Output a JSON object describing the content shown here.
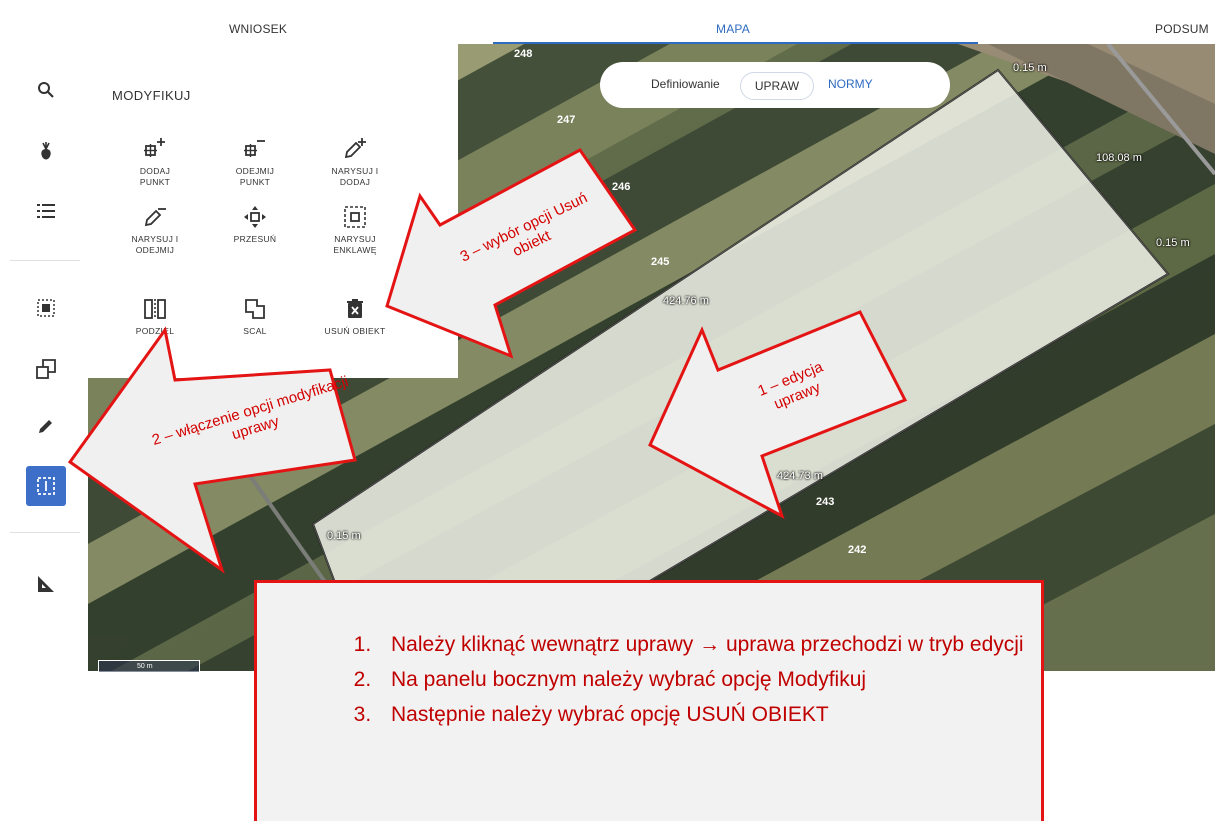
{
  "tabs": [
    {
      "label": "WNIOSEK"
    },
    {
      "label": "MAPA"
    },
    {
      "label": "PODSUM"
    }
  ],
  "map_toggle": {
    "label": "Definiowanie",
    "options": [
      "UPRAW",
      "NORMY"
    ],
    "selected": "UPRAW"
  },
  "panel": {
    "title": "MODYFIKUJ",
    "tools": [
      {
        "label": "DODAJ\nPUNKT",
        "icon": "add-point-icon"
      },
      {
        "label": "ODEJMIJ\nPUNKT",
        "icon": "remove-point-icon"
      },
      {
        "label": "NARYSUJ I\nDODAJ",
        "icon": "draw-add-icon"
      },
      {
        "label": "NARYSUJ I\nODEJMIJ",
        "icon": "draw-subtract-icon"
      },
      {
        "label": "PRZESUŃ",
        "icon": "move-icon"
      },
      {
        "label": "NARYSUJ\nENKLAWĘ",
        "icon": "draw-enclave-icon"
      },
      {
        "label": "PODZIEL",
        "icon": "split-icon"
      },
      {
        "label": "SCAL",
        "icon": "merge-icon"
      },
      {
        "label": "USUŃ OBIEKT",
        "icon": "delete-object-icon"
      }
    ]
  },
  "sidebar_icons": [
    "search-icon",
    "crop-icon",
    "list-icon",
    "select-area-icon",
    "copy-shape-icon",
    "edit-icon",
    "modify-icon",
    "measure-icon"
  ],
  "map": {
    "measurements": [
      "0.15 m",
      "108.08 m",
      "0.15 m",
      "424.76 m",
      "424.73 m",
      "0.15 m"
    ],
    "parcels": [
      "248",
      "247",
      "246",
      "245",
      "243",
      "242"
    ],
    "scale": "50 m"
  },
  "annotations": {
    "step1": "1 – edycja uprawy",
    "step2": "2 – włączenie opcji modyfikacji uprawy",
    "step3": "3 – wybór opcji Usuń obiekt"
  },
  "instructions": [
    "Należy kliknąć wewnątrz uprawy → uprawa przechodzi w tryb edycji",
    "Na panelu bocznym należy wybrać opcję Modyfikuj",
    "Następnie należy wybrać opcję USUŃ OBIEKT"
  ],
  "colors": {
    "accent": "#3e6fc8",
    "annotation": "#d40000"
  }
}
